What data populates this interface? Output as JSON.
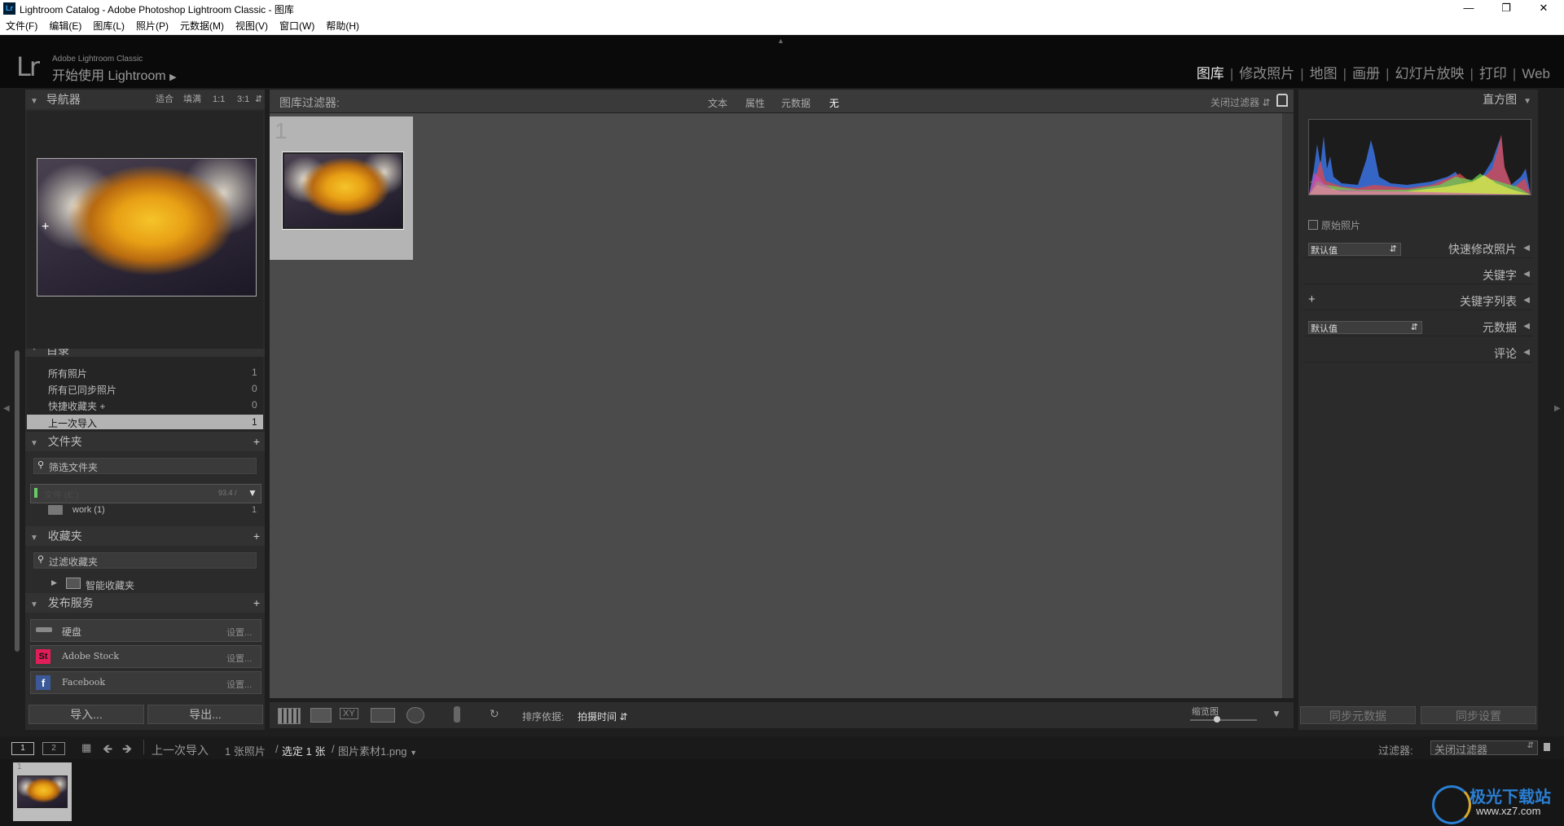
{
  "window": {
    "title": "Lightroom Catalog - Adobe Photoshop Lightroom Classic - 图库",
    "app_icon": "Lr"
  },
  "menu": [
    "文件(F)",
    "编辑(E)",
    "图库(L)",
    "照片(P)",
    "元数据(M)",
    "视图(V)",
    "窗口(W)",
    "帮助(H)"
  ],
  "identity": {
    "logo": "Lr",
    "product": "Adobe Lightroom Classic",
    "start": "开始使用 Lightroom"
  },
  "modules": [
    "图库",
    "修改照片",
    "地图",
    "画册",
    "幻灯片放映",
    "打印",
    "Web"
  ],
  "navigator": {
    "title": "导航器",
    "zoom": [
      "适合",
      "填满",
      "1:1",
      "3:1"
    ]
  },
  "catalog": {
    "title": "目录",
    "items": [
      {
        "label": "所有照片",
        "count": "1"
      },
      {
        "label": "所有已同步照片",
        "count": "0"
      },
      {
        "label": "快捷收藏夹 +",
        "count": "0"
      },
      {
        "label": "上一次导入",
        "count": "1"
      }
    ]
  },
  "folders": {
    "title": "文件夹",
    "filter_placeholder": "筛选文件夹",
    "volume": {
      "label": "文件 (E:)",
      "size": "93.4 /"
    },
    "items": [
      {
        "label": "work (1)",
        "count": "1"
      }
    ]
  },
  "collections": {
    "title": "收藏夹",
    "filter_placeholder": "过滤收藏夹",
    "items": [
      {
        "label": "智能收藏夹"
      }
    ]
  },
  "publish": {
    "title": "发布服务",
    "services": [
      {
        "label": "硬盘",
        "action": "设置..."
      },
      {
        "label": "Adobe Stock",
        "action": "设置..."
      },
      {
        "label": "Facebook",
        "action": "设置..."
      }
    ]
  },
  "left_buttons": {
    "import": "导入...",
    "export": "导出..."
  },
  "filterbar": {
    "title": "图库过滤器:",
    "options": [
      "文本",
      "属性",
      "元数据",
      "无"
    ],
    "off_label": "关闭过滤器"
  },
  "grid": {
    "cell_index": "1"
  },
  "toolbar": {
    "sort_label": "排序依据:",
    "sort_value": "拍摄时间",
    "thumb_label": "缩览图"
  },
  "right_panel": {
    "histogram_title": "直方图",
    "original_photo": "原始照片",
    "quick_develop": {
      "preset": "默认值",
      "title": "快速修改照片"
    },
    "keywords": "关键字",
    "keyword_list": "关键字列表",
    "metadata": {
      "preset": "默认值",
      "title": "元数据"
    },
    "comments": "评论",
    "sync_metadata": "同步元数据",
    "sync_settings": "同步设置"
  },
  "filmstrip": {
    "view1": "1",
    "view2": "2",
    "source": "上一次导入",
    "count_text": "1 张照片",
    "selected_text": "选定 1 张",
    "file_text": "图片素材1.png",
    "filter_label": "过滤器:",
    "filter_value": "关闭过滤器",
    "thumb_index": "1"
  },
  "watermark": {
    "brand": "极光下载站",
    "url": "www.xz7.com"
  }
}
